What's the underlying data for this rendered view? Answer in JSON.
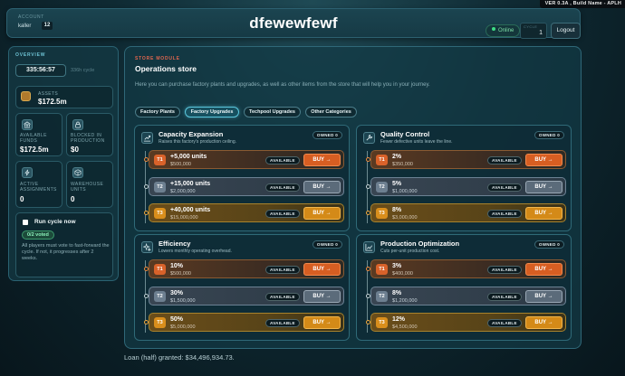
{
  "version_banner": "VER 0.3A , Build Name - APLH",
  "header": {
    "account_label": "ACCOUNT",
    "account_name": "kaller",
    "account_badge": "12",
    "title": "dfewewfewf",
    "status": "Online",
    "cycle_label": "CYCLE",
    "cycle_value": "1",
    "logout_label": "Logout"
  },
  "sidebar": {
    "title": "OVERVIEW",
    "timer": "335:56:57",
    "cycle_text": "336h cycle",
    "assets": {
      "label": "ASSETS",
      "value": "$172.5m"
    },
    "available_funds": {
      "label": "AVAILABLE FUNDS",
      "value": "$172.5m"
    },
    "blocked": {
      "label": "BLOCKED IN PRODUCTION",
      "value": "$0"
    },
    "active_assignments": {
      "label": "ACTIVE ASSIGNMENTS",
      "value": "0"
    },
    "warehouse": {
      "label": "WAREHOUSE UNITS",
      "value": "0"
    },
    "vote": {
      "label": "Run cycle now",
      "voted": "0/2 voted",
      "note": "All players must vote to fast-forward the cycle. If not, it progresses after 2 weeks."
    }
  },
  "store": {
    "tag": "STORE MODULE",
    "title": "Operations store",
    "description": "Here you can purchase factory plants and upgrades, as well as other items from the store that will help you in your journey.",
    "tabs": [
      {
        "label": "Factory Plants",
        "active": false
      },
      {
        "label": "Factory Upgrades",
        "active": true
      },
      {
        "label": "Techpool Upgrades",
        "active": false
      },
      {
        "label": "Other Categories",
        "active": false
      }
    ],
    "panels": [
      {
        "title": "Capacity Expansion",
        "subtitle": "Raises this factory's production ceiling.",
        "owned": "OWNED 0",
        "icon": "chart-up-icon",
        "tiers": [
          {
            "tier": "T1",
            "main": "+5,000 units",
            "price": "$500,000",
            "status": "AVAILABLE",
            "buy": "BUY →"
          },
          {
            "tier": "T2",
            "main": "+15,000 units",
            "price": "$2,000,000",
            "status": "AVAILABLE",
            "buy": "BUY →"
          },
          {
            "tier": "T3",
            "main": "+40,000 units",
            "price": "$15,000,000",
            "status": "AVAILABLE",
            "buy": "BUY →"
          }
        ]
      },
      {
        "title": "Quality Control",
        "subtitle": "Fewer defective units leave the line.",
        "owned": "OWNED 0",
        "icon": "wrench-icon",
        "tiers": [
          {
            "tier": "T1",
            "main": "2%",
            "price": "$350,000",
            "status": "AVAILABLE",
            "buy": "BUY →"
          },
          {
            "tier": "T2",
            "main": "5%",
            "price": "$1,000,000",
            "status": "AVAILABLE",
            "buy": "BUY →"
          },
          {
            "tier": "T3",
            "main": "8%",
            "price": "$3,000,000",
            "status": "AVAILABLE",
            "buy": "BUY →"
          }
        ]
      },
      {
        "title": "Efficiency",
        "subtitle": "Lowers monthly operating overhead.",
        "owned": "OWNED 0",
        "icon": "sparkle-icon",
        "tiers": [
          {
            "tier": "T1",
            "main": "10%",
            "price": "$500,000",
            "status": "AVAILABLE",
            "buy": "BUY →"
          },
          {
            "tier": "T2",
            "main": "30%",
            "price": "$1,500,000",
            "status": "AVAILABLE",
            "buy": "BUY →"
          },
          {
            "tier": "T3",
            "main": "50%",
            "price": "$5,000,000",
            "status": "AVAILABLE",
            "buy": "BUY →"
          }
        ]
      },
      {
        "title": "Production Optimization",
        "subtitle": "Cuts per-unit production cost.",
        "owned": "OWNED 0",
        "icon": "trend-chart-icon",
        "tiers": [
          {
            "tier": "T1",
            "main": "3%",
            "price": "$400,000",
            "status": "AVAILABLE",
            "buy": "BUY →"
          },
          {
            "tier": "T2",
            "main": "8%",
            "price": "$1,200,000",
            "status": "AVAILABLE",
            "buy": "BUY →"
          },
          {
            "tier": "T3",
            "main": "12%",
            "price": "$4,500,000",
            "status": "AVAILABLE",
            "buy": "BUY →"
          }
        ]
      }
    ]
  },
  "loan_text": "Loan (half) granted: $34,496,934.73."
}
